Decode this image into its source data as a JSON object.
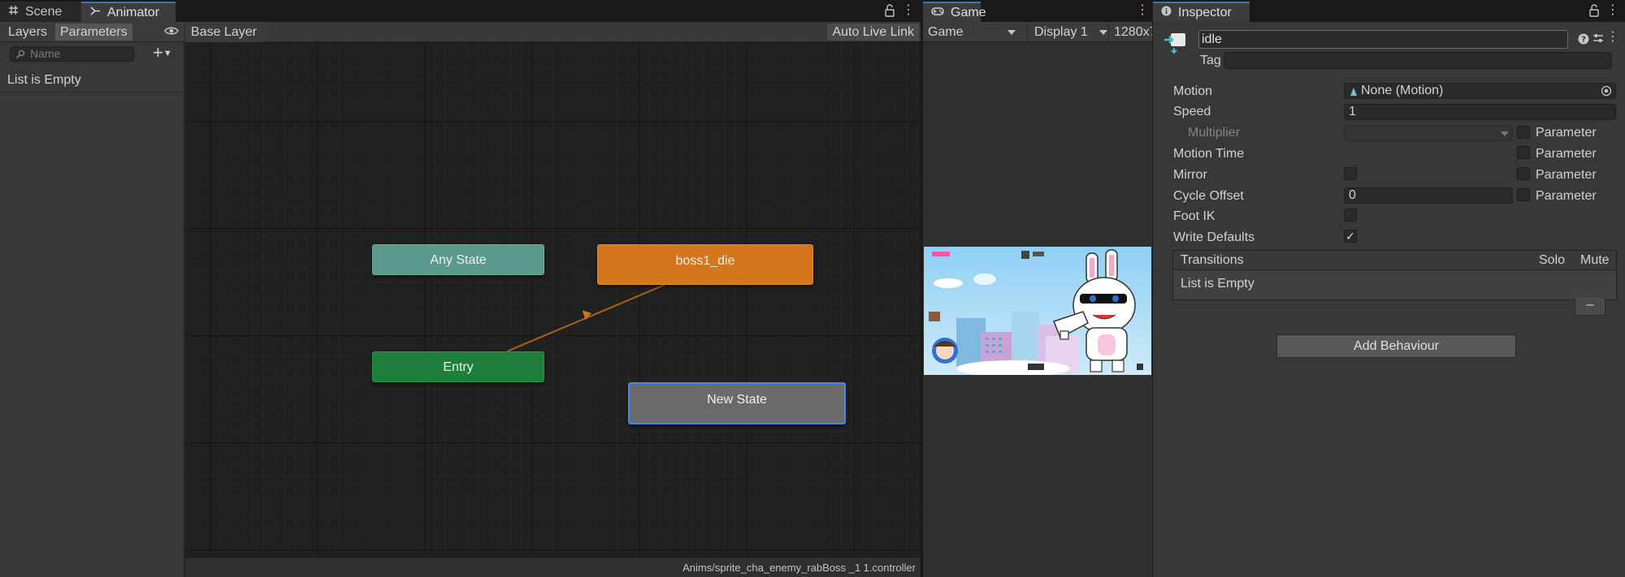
{
  "tabs": {
    "scene": "Scene",
    "animator": "Animator",
    "game": "Game",
    "inspector": "Inspector"
  },
  "animator": {
    "subtabs": {
      "layers": "Layers",
      "parameters": "Parameters"
    },
    "search_placeholder": "Name",
    "params_empty": "List is Empty",
    "breadcrumb": "Base Layer",
    "auto_live_link": "Auto Live Link",
    "nodes": {
      "any_state": "Any State",
      "boss1_die": "boss1_die",
      "entry": "Entry",
      "new_state": "New State"
    },
    "footer_path": "Anims/sprite_cha_enemy_rabBoss _1 1.controller",
    "colors": {
      "any_state": "#5a9a8c",
      "die": "#d4761c",
      "entry": "#1d7f3a",
      "new_state": "#6a6a6a",
      "selection": "#3d8de8",
      "transition": "#b06a1a"
    }
  },
  "game": {
    "display_mode": "Game",
    "display": "Display 1",
    "resolution": "1280x7"
  },
  "inspector": {
    "name_value": "idle",
    "tag_label": "Tag",
    "rows": {
      "motion_label": "Motion",
      "motion_value": "None (Motion)",
      "speed_label": "Speed",
      "speed_value": "1",
      "multiplier_label": "Multiplier",
      "motion_time_label": "Motion Time",
      "mirror_label": "Mirror",
      "cycle_offset_label": "Cycle Offset",
      "cycle_offset_value": "0",
      "foot_ik_label": "Foot IK",
      "write_defaults_label": "Write Defaults",
      "parameter_label": "Parameter"
    },
    "checks": {
      "mirror": false,
      "foot_ik": false,
      "write_defaults": true,
      "multiplier_param": false,
      "motion_time_param": false,
      "mirror_param": false,
      "cycle_offset_param": false
    },
    "transitions": {
      "header": "Transitions",
      "solo": "Solo",
      "mute": "Mute",
      "empty": "List is Empty",
      "remove": "–"
    },
    "add_behaviour": "Add Behaviour"
  }
}
